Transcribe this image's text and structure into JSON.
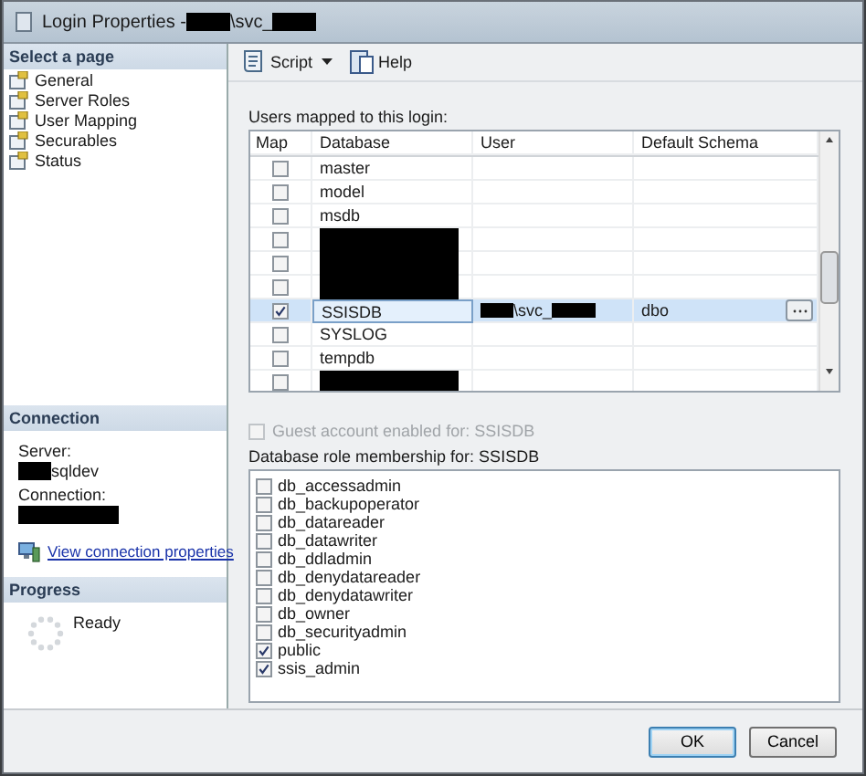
{
  "window": {
    "title": [
      {
        "kind": "text",
        "text": "Login Properties - "
      },
      {
        "kind": "redacted"
      },
      {
        "kind": "text",
        "text": "\\svc_"
      },
      {
        "kind": "redacted"
      }
    ]
  },
  "sidebar": {
    "header": "Select a page",
    "items": [
      {
        "label": "General",
        "selected": false
      },
      {
        "label": "Server Roles",
        "selected": false
      },
      {
        "label": "User Mapping",
        "selected": false
      },
      {
        "label": "Securables",
        "selected": false
      },
      {
        "label": "Status",
        "selected": false
      }
    ]
  },
  "connection": {
    "header": "Connection",
    "server_label": "Server:",
    "server": [
      {
        "kind": "redacted"
      },
      {
        "kind": "text",
        "text": "sqldev"
      }
    ],
    "connection_label": "Connection:",
    "connection": [
      {
        "kind": "redacted"
      }
    ],
    "link": "View connection properties"
  },
  "progress": {
    "header": "Progress",
    "status": "Ready"
  },
  "toolbar": {
    "items": [
      {
        "label": "Script",
        "kind": "script"
      },
      {
        "label": "Help",
        "kind": "help"
      }
    ]
  },
  "users_grid": {
    "label": "Users mapped to this login:",
    "columns": [
      "Map",
      "Database",
      "User",
      "Default Schema"
    ],
    "rows": [
      {
        "mapped": false,
        "selected": false,
        "database": [
          {
            "kind": "text",
            "text": "master"
          }
        ],
        "user": [],
        "schema": ""
      },
      {
        "mapped": false,
        "selected": false,
        "database": [
          {
            "kind": "text",
            "text": "model"
          }
        ],
        "user": [],
        "schema": ""
      },
      {
        "mapped": false,
        "selected": false,
        "database": [
          {
            "kind": "text",
            "text": "msdb"
          }
        ],
        "user": [],
        "schema": ""
      },
      {
        "mapped": false,
        "selected": false,
        "database": [
          {
            "kind": "redacted"
          }
        ],
        "user": [],
        "schema": ""
      },
      {
        "mapped": false,
        "selected": false,
        "database": [
          {
            "kind": "redacted"
          }
        ],
        "user": [],
        "schema": ""
      },
      {
        "mapped": false,
        "selected": false,
        "database": [
          {
            "kind": "redacted"
          }
        ],
        "user": [],
        "schema": ""
      },
      {
        "mapped": true,
        "selected": true,
        "database": [
          {
            "kind": "text",
            "text": "SSISDB"
          }
        ],
        "user": [
          {
            "kind": "redacted"
          },
          {
            "kind": "text",
            "text": "\\svc_"
          },
          {
            "kind": "redacted"
          }
        ],
        "schema": "dbo"
      },
      {
        "mapped": false,
        "selected": false,
        "database": [
          {
            "kind": "text",
            "text": "SYSLOG"
          }
        ],
        "user": [],
        "schema": ""
      },
      {
        "mapped": false,
        "selected": false,
        "database": [
          {
            "kind": "text",
            "text": "tempdb"
          }
        ],
        "user": [],
        "schema": ""
      },
      {
        "mapped": false,
        "selected": false,
        "database": [
          {
            "kind": "redacted"
          }
        ],
        "user": [],
        "schema": ""
      }
    ]
  },
  "guest": {
    "label": "Guest account enabled for: SSISDB",
    "checked": false,
    "disabled": true
  },
  "roles": {
    "label": "Database role membership for: SSISDB",
    "items": [
      {
        "label": "db_accessadmin",
        "checked": false
      },
      {
        "label": "db_backupoperator",
        "checked": false
      },
      {
        "label": "db_datareader",
        "checked": false
      },
      {
        "label": "db_datawriter",
        "checked": false
      },
      {
        "label": "db_ddladmin",
        "checked": false
      },
      {
        "label": "db_denydatareader",
        "checked": false
      },
      {
        "label": "db_denydatawriter",
        "checked": false
      },
      {
        "label": "db_owner",
        "checked": false
      },
      {
        "label": "db_securityadmin",
        "checked": false
      },
      {
        "label": "public",
        "checked": true
      },
      {
        "label": "ssis_admin",
        "checked": true
      }
    ]
  },
  "buttons": [
    {
      "label": "OK",
      "default": true
    },
    {
      "label": "Cancel",
      "default": false
    }
  ]
}
